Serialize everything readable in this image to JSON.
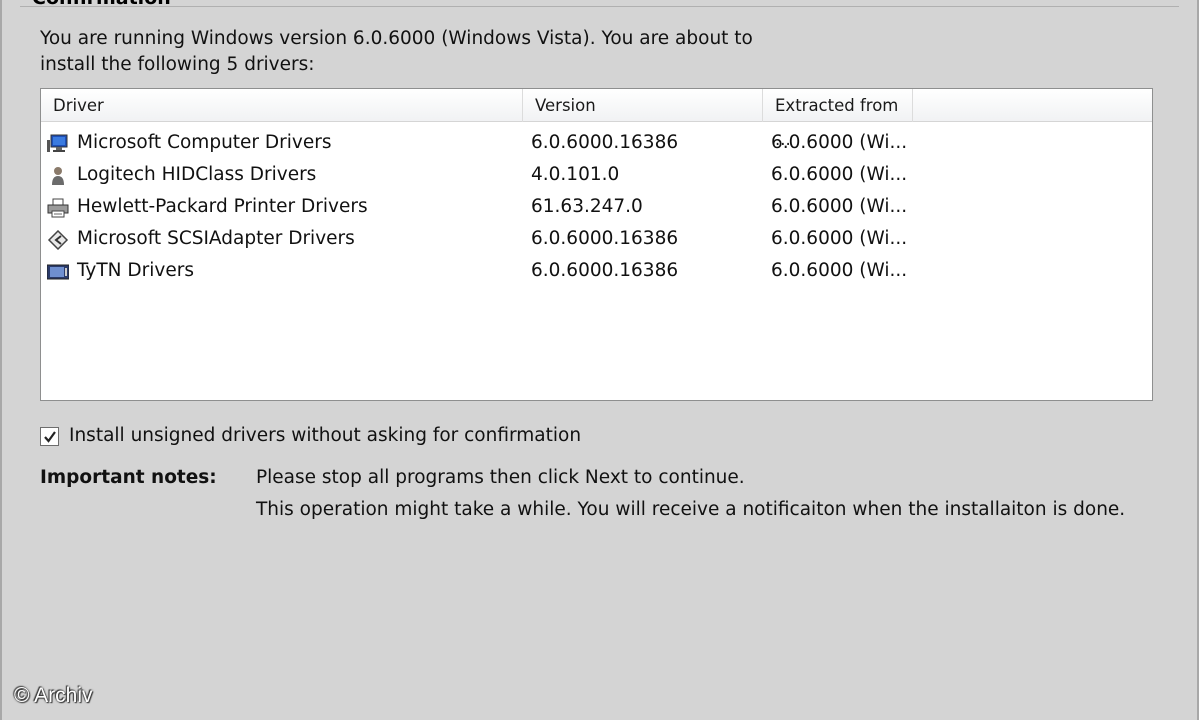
{
  "section": {
    "title": "Confirmation"
  },
  "intro": {
    "line1": "You are running Windows version 6.0.6000 (Windows Vista). You are about to",
    "line2": "install the following 5 drivers:"
  },
  "table": {
    "columns": [
      "Driver",
      "Version",
      "Extracted from ..."
    ],
    "rows": [
      {
        "icon": "computer-monitor-icon",
        "name": "Microsoft Computer Drivers",
        "version": "6.0.6000.16386",
        "extracted": "6.0.6000 (Wi..."
      },
      {
        "icon": "person-icon",
        "name": "Logitech HIDClass Drivers",
        "version": "4.0.101.0",
        "extracted": "6.0.6000 (Wi..."
      },
      {
        "icon": "printer-icon",
        "name": "Hewlett-Packard Printer Drivers",
        "version": "61.63.247.0",
        "extracted": "6.0.6000 (Wi..."
      },
      {
        "icon": "scsi-adapter-icon",
        "name": "Microsoft SCSIAdapter Drivers",
        "version": "6.0.6000.16386",
        "extracted": "6.0.6000 (Wi..."
      },
      {
        "icon": "device-icon",
        "name": "TyTN Drivers",
        "version": "6.0.6000.16386",
        "extracted": "6.0.6000 (Wi..."
      }
    ]
  },
  "options": {
    "install_unsigned_label": "Install unsigned drivers without asking for confirmation",
    "install_unsigned_checked": true
  },
  "notes": {
    "label": "Important notes:",
    "line1": "Please stop all programs then click Next to continue.",
    "line2": "This operation might take a while. You will receive a notificaiton when the installaiton is done."
  },
  "watermark": "© Archiv"
}
